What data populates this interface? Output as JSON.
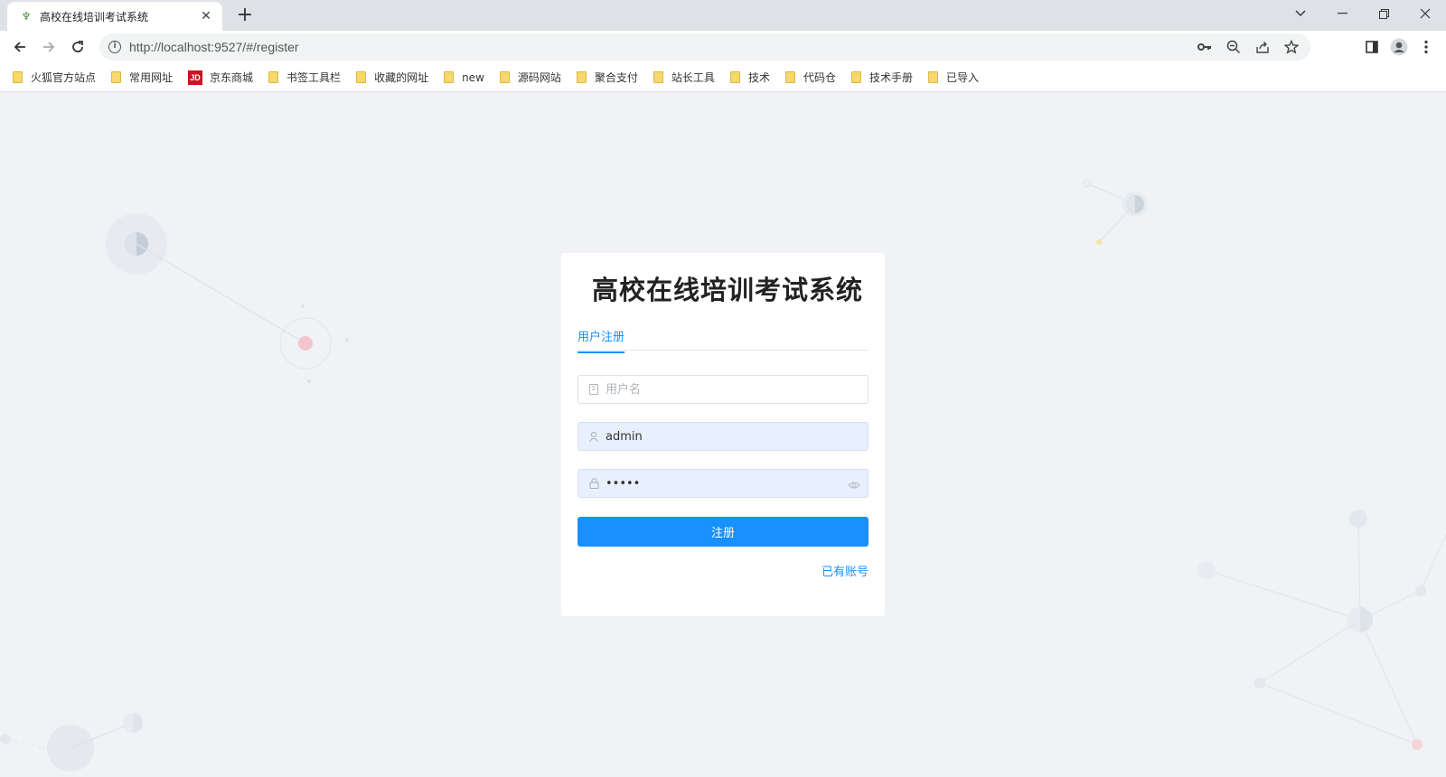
{
  "browser": {
    "tab_title": "高校在线培训考试系统",
    "url": "http://localhost:9527/#/register",
    "bookmarks": [
      {
        "label": "火狐官方站点",
        "icon": "folder-icon"
      },
      {
        "label": "常用网址",
        "icon": "folder-icon"
      },
      {
        "label": "京东商城",
        "icon": "jd-icon"
      },
      {
        "label": "书签工具栏",
        "icon": "folder-icon"
      },
      {
        "label": "收藏的网址",
        "icon": "folder-icon"
      },
      {
        "label": "new",
        "icon": "folder-icon"
      },
      {
        "label": "源码网站",
        "icon": "folder-icon"
      },
      {
        "label": "聚合支付",
        "icon": "folder-icon"
      },
      {
        "label": "站长工具",
        "icon": "folder-icon"
      },
      {
        "label": "技术",
        "icon": "folder-icon"
      },
      {
        "label": "代码仓",
        "icon": "folder-icon"
      },
      {
        "label": "技术手册",
        "icon": "folder-icon"
      },
      {
        "label": "已导入",
        "icon": "folder-icon"
      }
    ],
    "jd_badge": "JD"
  },
  "register": {
    "title": "高校在线培训考试系统",
    "tab_label": "用户注册",
    "fields": {
      "name": {
        "placeholder": "用户名",
        "value": ""
      },
      "username": {
        "placeholder": "",
        "value": "admin"
      },
      "password": {
        "placeholder": "",
        "value": "12345"
      }
    },
    "submit_label": "注册",
    "login_link": "已有账号"
  },
  "colors": {
    "primary": "#1890ff",
    "background": "#f0f2f5"
  }
}
